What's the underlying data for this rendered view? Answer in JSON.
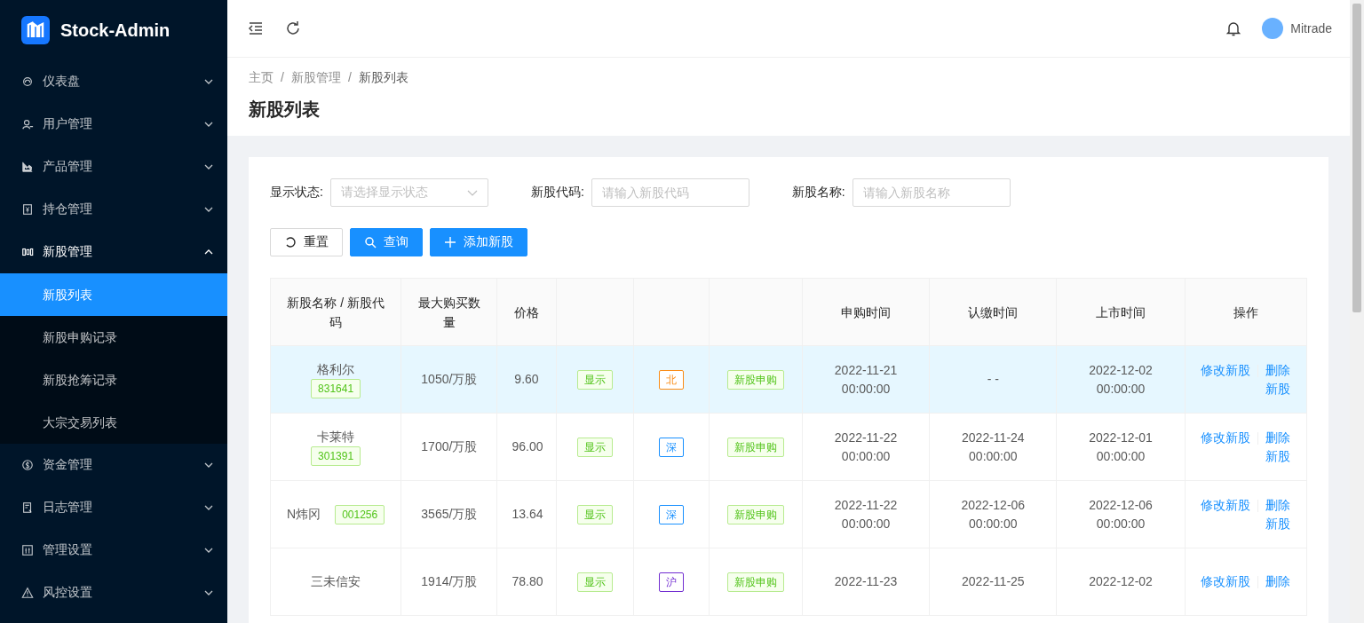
{
  "sidebar": {
    "logo": "Stock-Admin",
    "items": [
      {
        "label": "仪表盘",
        "expanded": false
      },
      {
        "label": "用户管理",
        "expanded": false
      },
      {
        "label": "产品管理",
        "expanded": false
      },
      {
        "label": "持仓管理",
        "expanded": false
      },
      {
        "label": "新股管理",
        "expanded": true,
        "children": [
          {
            "label": "新股列表",
            "selected": true
          },
          {
            "label": "新股申购记录",
            "selected": false
          },
          {
            "label": "新股抢筹记录",
            "selected": false
          },
          {
            "label": "大宗交易列表",
            "selected": false
          }
        ]
      },
      {
        "label": "资金管理",
        "expanded": false
      },
      {
        "label": "日志管理",
        "expanded": false
      },
      {
        "label": "管理设置",
        "expanded": false
      },
      {
        "label": "风控设置",
        "expanded": false
      }
    ]
  },
  "header": {
    "username": "Mitrade"
  },
  "breadcrumb": {
    "items": [
      "主页",
      "新股管理",
      "新股列表"
    ],
    "separator": "/"
  },
  "page_title": "新股列表",
  "filters": [
    {
      "kind": "select",
      "label": "显示状态:",
      "placeholder": "请选择显示状态"
    },
    {
      "kind": "input",
      "label": "新股代码:",
      "placeholder": "请输入新股代码"
    },
    {
      "kind": "input",
      "label": "新股名称:",
      "placeholder": "请输入新股名称"
    }
  ],
  "buttons": [
    {
      "kind": "default",
      "label": "重置"
    },
    {
      "kind": "primary",
      "label": "查询"
    },
    {
      "kind": "primary",
      "label": "添加新股"
    }
  ],
  "table": {
    "columns": {
      "column_1": "新股名称 / 新股代码",
      "column_2": "最大购买数量",
      "column_3": "价格",
      "column_7": "申购时间",
      "column_8": "认缴时间",
      "column_9": "上市时间",
      "column_10": "操作"
    },
    "rows": [
      {
        "selected": true,
        "name": "格利尔",
        "code": "831641",
        "code_beside_name": false,
        "max_qty": "1050/万股",
        "price": "9.60",
        "status": "显示",
        "exchange": {
          "text": "北",
          "color": "#fa8c16"
        },
        "type": "新股申购",
        "subscribe_time": "2022-11-21 00:00:00",
        "pay_time": "- -",
        "list_time": "2022-12-02 00:00:00",
        "actions": [
          "修改新股",
          "删除新股"
        ]
      },
      {
        "selected": false,
        "name": "卡莱特",
        "code": "301391",
        "code_beside_name": false,
        "max_qty": "1700/万股",
        "price": "96.00",
        "status": "显示",
        "exchange": {
          "text": "深",
          "color": "#1890ff"
        },
        "type": "新股申购",
        "subscribe_time": "2022-11-22 00:00:00",
        "pay_time": "2022-11-24 00:00:00",
        "list_time": "2022-12-01 00:00:00",
        "actions": [
          "修改新股",
          "删除新股"
        ]
      },
      {
        "selected": false,
        "name": "N炜冈",
        "code": "001256",
        "code_beside_name": true,
        "max_qty": "3565/万股",
        "price": "13.64",
        "status": "显示",
        "exchange": {
          "text": "深",
          "color": "#1890ff"
        },
        "type": "新股申购",
        "subscribe_time": "2022-11-22 00:00:00",
        "pay_time": "2022-12-06 00:00:00",
        "list_time": "2022-12-06 00:00:00",
        "actions": [
          "修改新股",
          "删除新股"
        ]
      },
      {
        "selected": false,
        "name": "三未信安",
        "max_qty": "1914/万股",
        "price": "78.80",
        "status": "显示",
        "exchange": {
          "text": "沪",
          "color": "#722ed1"
        },
        "type": "新股申购",
        "subscribe_time": "2022-11-23",
        "pay_time": "2022-11-25",
        "list_time": "2022-12-02",
        "actions": [
          "修改新股",
          "删除"
        ]
      }
    ]
  }
}
